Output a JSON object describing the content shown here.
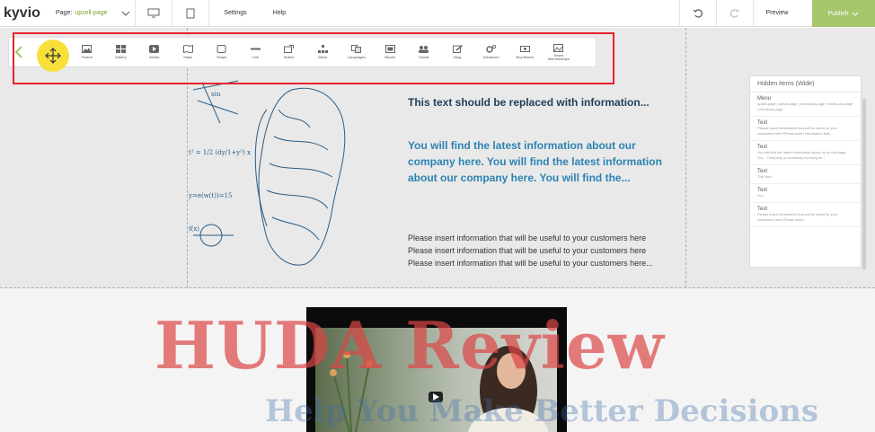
{
  "app": {
    "logo": "kyvio"
  },
  "topbar": {
    "page_label": "Page:",
    "page_value": "upsell-page",
    "settings": "Settings",
    "help": "Help",
    "preview": "Preview",
    "publish": "Publish"
  },
  "toolbar": {
    "items": [
      {
        "label": "Picture",
        "icon": "picture-icon"
      },
      {
        "label": "Gallery",
        "icon": "gallery-icon"
      },
      {
        "label": "Media",
        "icon": "media-icon"
      },
      {
        "label": "Maps",
        "icon": "map-icon"
      },
      {
        "label": "Shape",
        "icon": "shape-icon"
      },
      {
        "label": "Line",
        "icon": "line-icon"
      },
      {
        "label": "Button",
        "icon": "button-icon"
      },
      {
        "label": "Menu",
        "icon": "menu-icon"
      },
      {
        "label": "Languages",
        "icon": "languages-icon"
      },
      {
        "label": "Blocks",
        "icon": "blocks-icon"
      },
      {
        "label": "Social",
        "icon": "social-icon"
      },
      {
        "label": "Blog",
        "icon": "blog-icon"
      },
      {
        "label": "Advanced",
        "icon": "advanced-icon"
      },
      {
        "label": "Buy Button",
        "icon": "buy-button-icon"
      },
      {
        "label": "Smart Memberships",
        "icon": "smart-memberships-icon"
      }
    ]
  },
  "content": {
    "heading": "This text should be replaced with information...",
    "info": "You will find the latest information about our company here. You will find the latest information about our company here. You will find the...",
    "lines": [
      "Please insert information that will be useful to your customers here",
      "Please insert information that will be useful to your customers here",
      "Please insert information that will be useful to your customers here..."
    ]
  },
  "hidden_panel": {
    "title": "Hidden items (Wide)",
    "items": [
      {
        "title": "Menu",
        "desc": "upsell-page | upsell-page | download-page | thank-you-page | checkout-page"
      },
      {
        "title": "Text",
        "desc": "Please insert information that will be useful to your customers here Please insert information that..."
      },
      {
        "title": "Text",
        "desc": "You will find the latest information about us on this page. Our... Company is constantly evolving an..."
      },
      {
        "title": "Text",
        "desc": "This text..."
      },
      {
        "title": "Text",
        "desc": "You"
      },
      {
        "title": "Text",
        "desc": "Please insert information that will be useful to your customers here Please insert"
      }
    ]
  },
  "watermark": {
    "line1": "HUDA Review",
    "line2": "Help You Make Better Decisions"
  },
  "colors": {
    "accent": "#a6c66b",
    "highlight": "#e8232f",
    "heading": "#1f3f5a",
    "info": "#2d83b3"
  }
}
